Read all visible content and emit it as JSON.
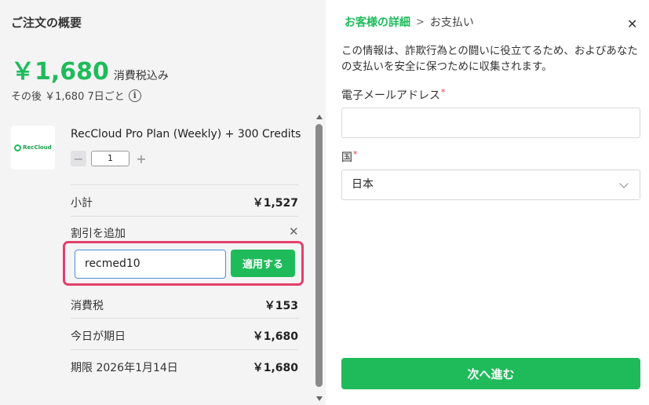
{
  "order": {
    "title": "ご注文の概要",
    "total_price": "￥1,680",
    "tax_included": "消費税込み",
    "after_text": "その後 ￥1,680 7日ごと",
    "info_icon": "info-circle-icon"
  },
  "product": {
    "logo_text": "RecCloud",
    "name": "RecCloud Pro Plan (Weekly) + 300 Credits",
    "quantity": "1",
    "minus": "−",
    "plus": "+"
  },
  "lines": {
    "subtotal_label": "小計",
    "subtotal_value": "￥1,527",
    "discount_label": "割引を追加",
    "discount_close": "✕",
    "coupon_value": "recmed10",
    "apply_label": "適用する",
    "tax_label": "消費税",
    "tax_value": "￥153",
    "due_today_label": "今日が期日",
    "due_today_value": "￥1,680",
    "deadline_label": "期限 2026年1月14日",
    "deadline_value": "￥1,680"
  },
  "checkout": {
    "breadcrumb_active": "お客様の詳細",
    "breadcrumb_sep": ">",
    "breadcrumb_next": "お支払い",
    "close": "✕",
    "info_text": "この情報は、詐欺行為との闘いに役立てるため、およびあなたの支払いを安全に保つために収集されます。",
    "email_label": "電子メールアドレス",
    "email_value": "",
    "country_label": "国",
    "country_value": "日本",
    "required_mark": "*",
    "next_label": "次へ進む"
  },
  "colors": {
    "accent": "#1fbb5b",
    "highlight": "#e2406b",
    "left_bg": "#f4f4f5"
  }
}
